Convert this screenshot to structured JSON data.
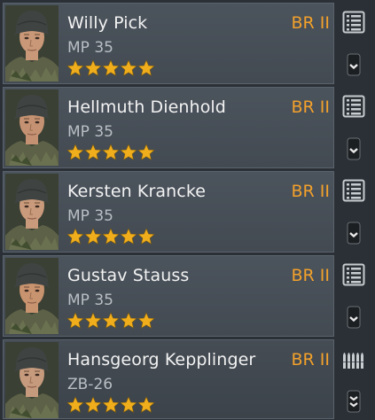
{
  "soldiers": [
    {
      "name": "Willy Pick",
      "weapon": "MP 35",
      "battle_rating": "BR II",
      "stars": 5,
      "top_icon": "list-icon",
      "bottom_icon": "rank-one-chevron-icon"
    },
    {
      "name": "Hellmuth Dienhold",
      "weapon": "MP 35",
      "battle_rating": "BR II",
      "stars": 5,
      "top_icon": "list-icon",
      "bottom_icon": "rank-one-chevron-icon"
    },
    {
      "name": "Kersten Krancke",
      "weapon": "MP 35",
      "battle_rating": "BR II",
      "stars": 5,
      "top_icon": "list-icon",
      "bottom_icon": "rank-one-chevron-icon"
    },
    {
      "name": "Gustav Stauss",
      "weapon": "MP 35",
      "battle_rating": "BR II",
      "stars": 5,
      "top_icon": "list-icon",
      "bottom_icon": "rank-one-chevron-icon"
    },
    {
      "name": "Hansgeorg Kepplinger",
      "weapon": "ZB-26",
      "battle_rating": "BR II",
      "stars": 5,
      "top_icon": "ammo-icon",
      "bottom_icon": "rank-two-chevron-icon"
    }
  ],
  "colors": {
    "accent": "#f3a12b",
    "star": "#f0ad1c",
    "card": "#4b535c",
    "name_text": "#f2f2f2",
    "weapon_text": "#b9bfc4"
  }
}
